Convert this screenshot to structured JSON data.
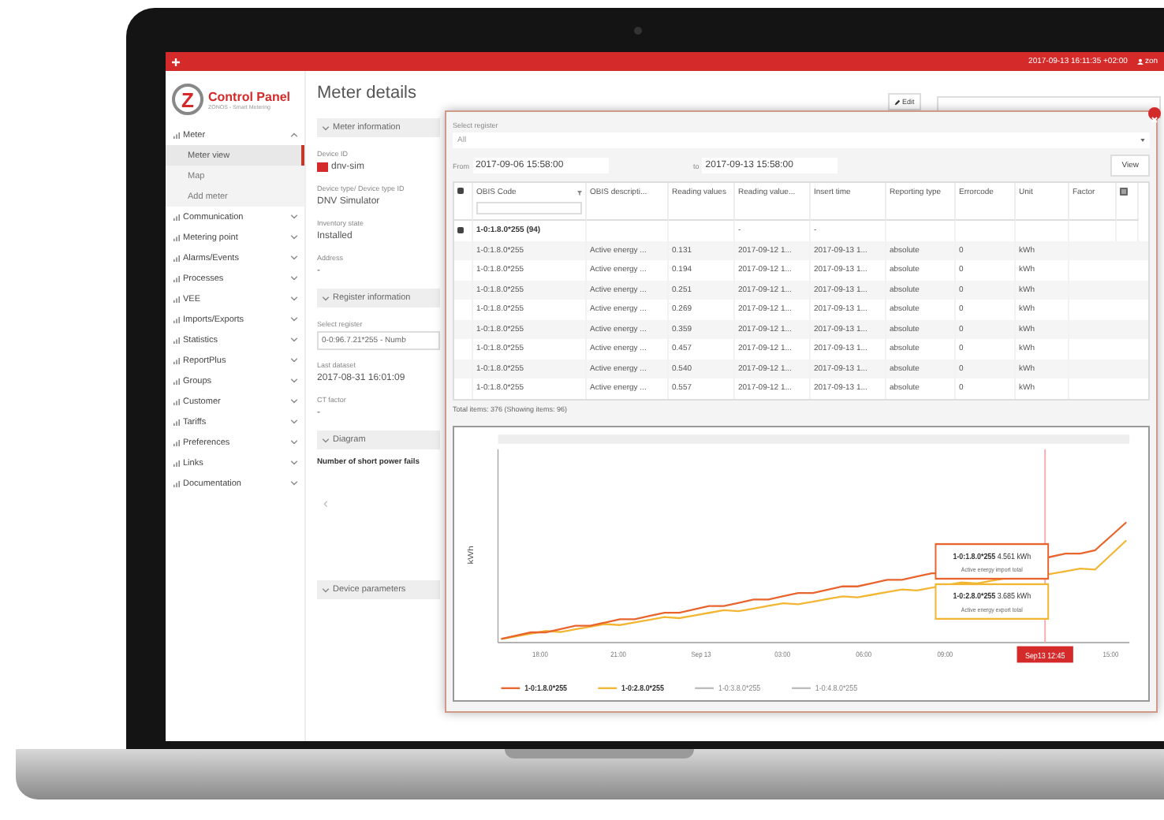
{
  "top_bar": {
    "clock": "2017-09-13 16:11:35 +02:00",
    "user": "zon"
  },
  "brand": {
    "logo_letter": "Z",
    "title": "Control Panel",
    "subtitle": "ZONOS - Smart Metering"
  },
  "sidebar": {
    "items": [
      {
        "label": "Meter",
        "expanded": true,
        "children": [
          {
            "label": "Meter view",
            "selected": true
          },
          {
            "label": "Map",
            "selected": false
          },
          {
            "label": "Add meter",
            "selected": false
          }
        ]
      },
      {
        "label": "Communication",
        "expanded": false
      },
      {
        "label": "Metering point",
        "expanded": false
      },
      {
        "label": "Alarms/Events",
        "expanded": false
      },
      {
        "label": "Processes",
        "expanded": false
      },
      {
        "label": "VEE",
        "expanded": false
      },
      {
        "label": "Imports/Exports",
        "expanded": false
      },
      {
        "label": "Statistics",
        "expanded": false
      },
      {
        "label": "ReportPlus",
        "expanded": false
      },
      {
        "label": "Groups",
        "expanded": false
      },
      {
        "label": "Customer",
        "expanded": false
      },
      {
        "label": "Tariffs",
        "expanded": false
      },
      {
        "label": "Preferences",
        "expanded": false
      },
      {
        "label": "Links",
        "expanded": false
      },
      {
        "label": "Documentation",
        "expanded": false
      }
    ]
  },
  "page": {
    "title": "Meter details",
    "edit_button": "Edit",
    "sections": [
      {
        "title": "Meter information",
        "fields": [
          {
            "kind": "device",
            "label": "Device ID",
            "value": "dnv-sim"
          },
          {
            "kind": "text",
            "label": "Device type/ Device type ID",
            "value": "DNV Simulator"
          },
          {
            "kind": "text",
            "label": "Inventory state",
            "value": "Installed"
          },
          {
            "kind": "text",
            "label": "Address",
            "value": "-"
          }
        ]
      },
      {
        "title": "Register information",
        "fields": [
          {
            "kind": "select",
            "label": "Select register",
            "value": "0-0:96.7.21*255 - Numb"
          },
          {
            "kind": "text",
            "label": "Last dataset",
            "value": "2017-08-31 16:01:09"
          },
          {
            "kind": "text",
            "label": "CT factor",
            "value": "-"
          }
        ]
      },
      {
        "title": "Diagram",
        "fields": [
          {
            "kind": "heading",
            "value": "Number of short power fails"
          },
          {
            "kind": "pager",
            "value": "‹"
          }
        ]
      },
      {
        "title": "Device parameters"
      }
    ]
  },
  "dialog": {
    "register_label": "Select register",
    "register_value": "All",
    "from_label": "From",
    "from": "2017-09-06 15:58:00",
    "to_label": "to",
    "to": "2017-09-13 15:58:00",
    "view_button": "View",
    "table": {
      "columns": [
        "OBIS Code",
        "OBIS descripti...",
        "Reading values",
        "Reading value...",
        "Insert time",
        "Reporting type",
        "Errorcode",
        "Unit",
        "Factor"
      ],
      "group": {
        "label": "1-0:1.8.0*255 (94)",
        "reading_value_time": "-",
        "insert_time": "-"
      },
      "rows": [
        [
          "1-0:1.8.0*255",
          "Active energy ...",
          "0.131",
          "2017-09-12 1...",
          "2017-09-13 1...",
          "absolute",
          "0",
          "kWh"
        ],
        [
          "1-0:1.8.0*255",
          "Active energy ...",
          "0.194",
          "2017-09-12 1...",
          "2017-09-13 1...",
          "absolute",
          "0",
          "kWh"
        ],
        [
          "1-0:1.8.0*255",
          "Active energy ...",
          "0.251",
          "2017-09-12 1...",
          "2017-09-13 1...",
          "absolute",
          "0",
          "kWh"
        ],
        [
          "1-0:1.8.0*255",
          "Active energy ...",
          "0.269",
          "2017-09-12 1...",
          "2017-09-13 1...",
          "absolute",
          "0",
          "kWh"
        ],
        [
          "1-0:1.8.0*255",
          "Active energy ...",
          "0.359",
          "2017-09-12 1...",
          "2017-09-13 1...",
          "absolute",
          "0",
          "kWh"
        ],
        [
          "1-0:1.8.0*255",
          "Active energy ...",
          "0.457",
          "2017-09-12 1...",
          "2017-09-13 1...",
          "absolute",
          "0",
          "kWh"
        ],
        [
          "1-0:1.8.0*255",
          "Active energy ...",
          "0.540",
          "2017-09-12 1...",
          "2017-09-13 1...",
          "absolute",
          "0",
          "kWh"
        ],
        [
          "1-0:1.8.0*255",
          "Active energy ...",
          "0.557",
          "2017-09-12 1...",
          "2017-09-13 1...",
          "absolute",
          "0",
          "kWh"
        ]
      ],
      "total": "Total items: 376 (Showing items: 96)"
    },
    "chart": {
      "y_label": "kWh",
      "x_labels": [
        "18:00",
        "21:00",
        "Sep 13",
        "03:00",
        "06:00",
        "09:00",
        "15:00"
      ],
      "cursor_label": "Sep13 12:45",
      "tooltips": [
        {
          "series": "1-0:1.8.0*255",
          "value": "4.561 kWh",
          "description": "Active energy import total",
          "color": "#e8642c"
        },
        {
          "series": "1-0:2.8.0*255",
          "value": "3.685 kWh",
          "description": "Active energy export total",
          "color": "#f2b632"
        }
      ],
      "legend": [
        {
          "label": "1-0:1.8.0*255",
          "color": "#e8642c",
          "visible": true
        },
        {
          "label": "1-0:2.8.0*255",
          "color": "#f2b632",
          "visible": true
        },
        {
          "label": "1-0:3.8.0*255",
          "visible": false
        },
        {
          "label": "1-0:4.8.0*255",
          "visible": false
        }
      ]
    }
  }
}
